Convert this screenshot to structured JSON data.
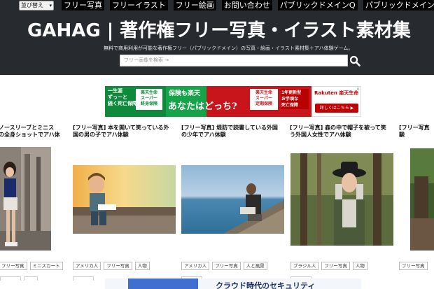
{
  "header": {
    "sort_select": "並び替え",
    "nav": [
      "フリー写真",
      "フリーイラスト",
      "フリー絵画",
      "お問い合わせ",
      "パブリックドメインQ",
      "パブリックドメイン"
    ],
    "title": "GAHAG | 著作権フリー写真・イラスト素材集",
    "description": "無料で商用利用が可能な著作権フリー（パブリックドメイン）の写真・絵画・イラスト素材集＋アハ体験ゲーム。",
    "search_placeholder": "フリー画像を検索 →"
  },
  "ad": {
    "seg1_text": "一生涯\nずっーと\n続く死亡保障",
    "seg1_box": "楽天生命\nスーパー\n終身保険",
    "seg2_text": "保険も楽天",
    "seg3_text": "あなたはどっち?",
    "seg3_box": "楽天生命\nスーパー\n定期保険",
    "seg3_new": "1年更新型\nお手頃な\n死亡保障",
    "brand": "Rakuten 楽天生命",
    "cta": "詳しくはこちら ▶",
    "close": "✕"
  },
  "cards": [
    {
      "title_line1": "ノースリーブとミニス",
      "title_line2": "の全身ショットでアハ体",
      "tags": [
        "フリー写真",
        "ミニスカート"
      ]
    },
    {
      "title_line1": "[フリー写真] 本を開いて笑っている外",
      "title_line2": "国の男の子でアハ体験",
      "tags": [
        "アメリカ人",
        "フリー写真",
        "人物"
      ]
    },
    {
      "title_line1": "[フリー写真] 堤防で読書している外国",
      "title_line2": "の少年でアハ体験",
      "tags": [
        "アメリカ人",
        "フリー写真",
        "人と風景"
      ]
    },
    {
      "title_line1": "[フリー写真] 森の中で帽子を被って笑",
      "title_line2": "う外国人女性でアハ体験",
      "tags": [
        "ブラジル人",
        "フリー写真",
        "人物"
      ]
    },
    {
      "title_line1": "[フリー写真",
      "title_line2": "験",
      "tags": [
        "フリー写真"
      ]
    }
  ],
  "bottom_ad": {
    "text": "クラウド時代のセキュリティ"
  }
}
